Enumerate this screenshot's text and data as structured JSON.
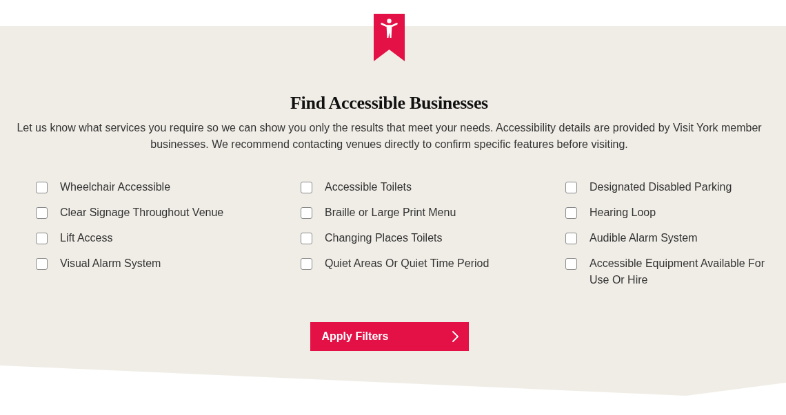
{
  "heading": "Find Accessible Businesses",
  "description": "Let us know what services you require so we can show you only the results that meet your needs. Accessibility details are provided by Visit York member businesses. We recommend contacting venues directly to confirm specific features before visiting.",
  "filters": [
    {
      "label": "Wheelchair Accessible",
      "checked": false
    },
    {
      "label": "Accessible Toilets",
      "checked": false
    },
    {
      "label": "Designated Disabled Parking",
      "checked": false
    },
    {
      "label": "Clear Signage Throughout Venue",
      "checked": false
    },
    {
      "label": "Braille or Large Print Menu",
      "checked": false
    },
    {
      "label": "Hearing Loop",
      "checked": false
    },
    {
      "label": "Lift Access",
      "checked": false
    },
    {
      "label": "Changing Places Toilets",
      "checked": false
    },
    {
      "label": "Audible Alarm System",
      "checked": false
    },
    {
      "label": "Visual Alarm System",
      "checked": false
    },
    {
      "label": "Quiet Areas Or Quiet Time Period",
      "checked": false
    },
    {
      "label": "Accessible Equipment Available For Use Or Hire",
      "checked": false
    }
  ],
  "apply_button": {
    "label": "Apply Filters"
  }
}
